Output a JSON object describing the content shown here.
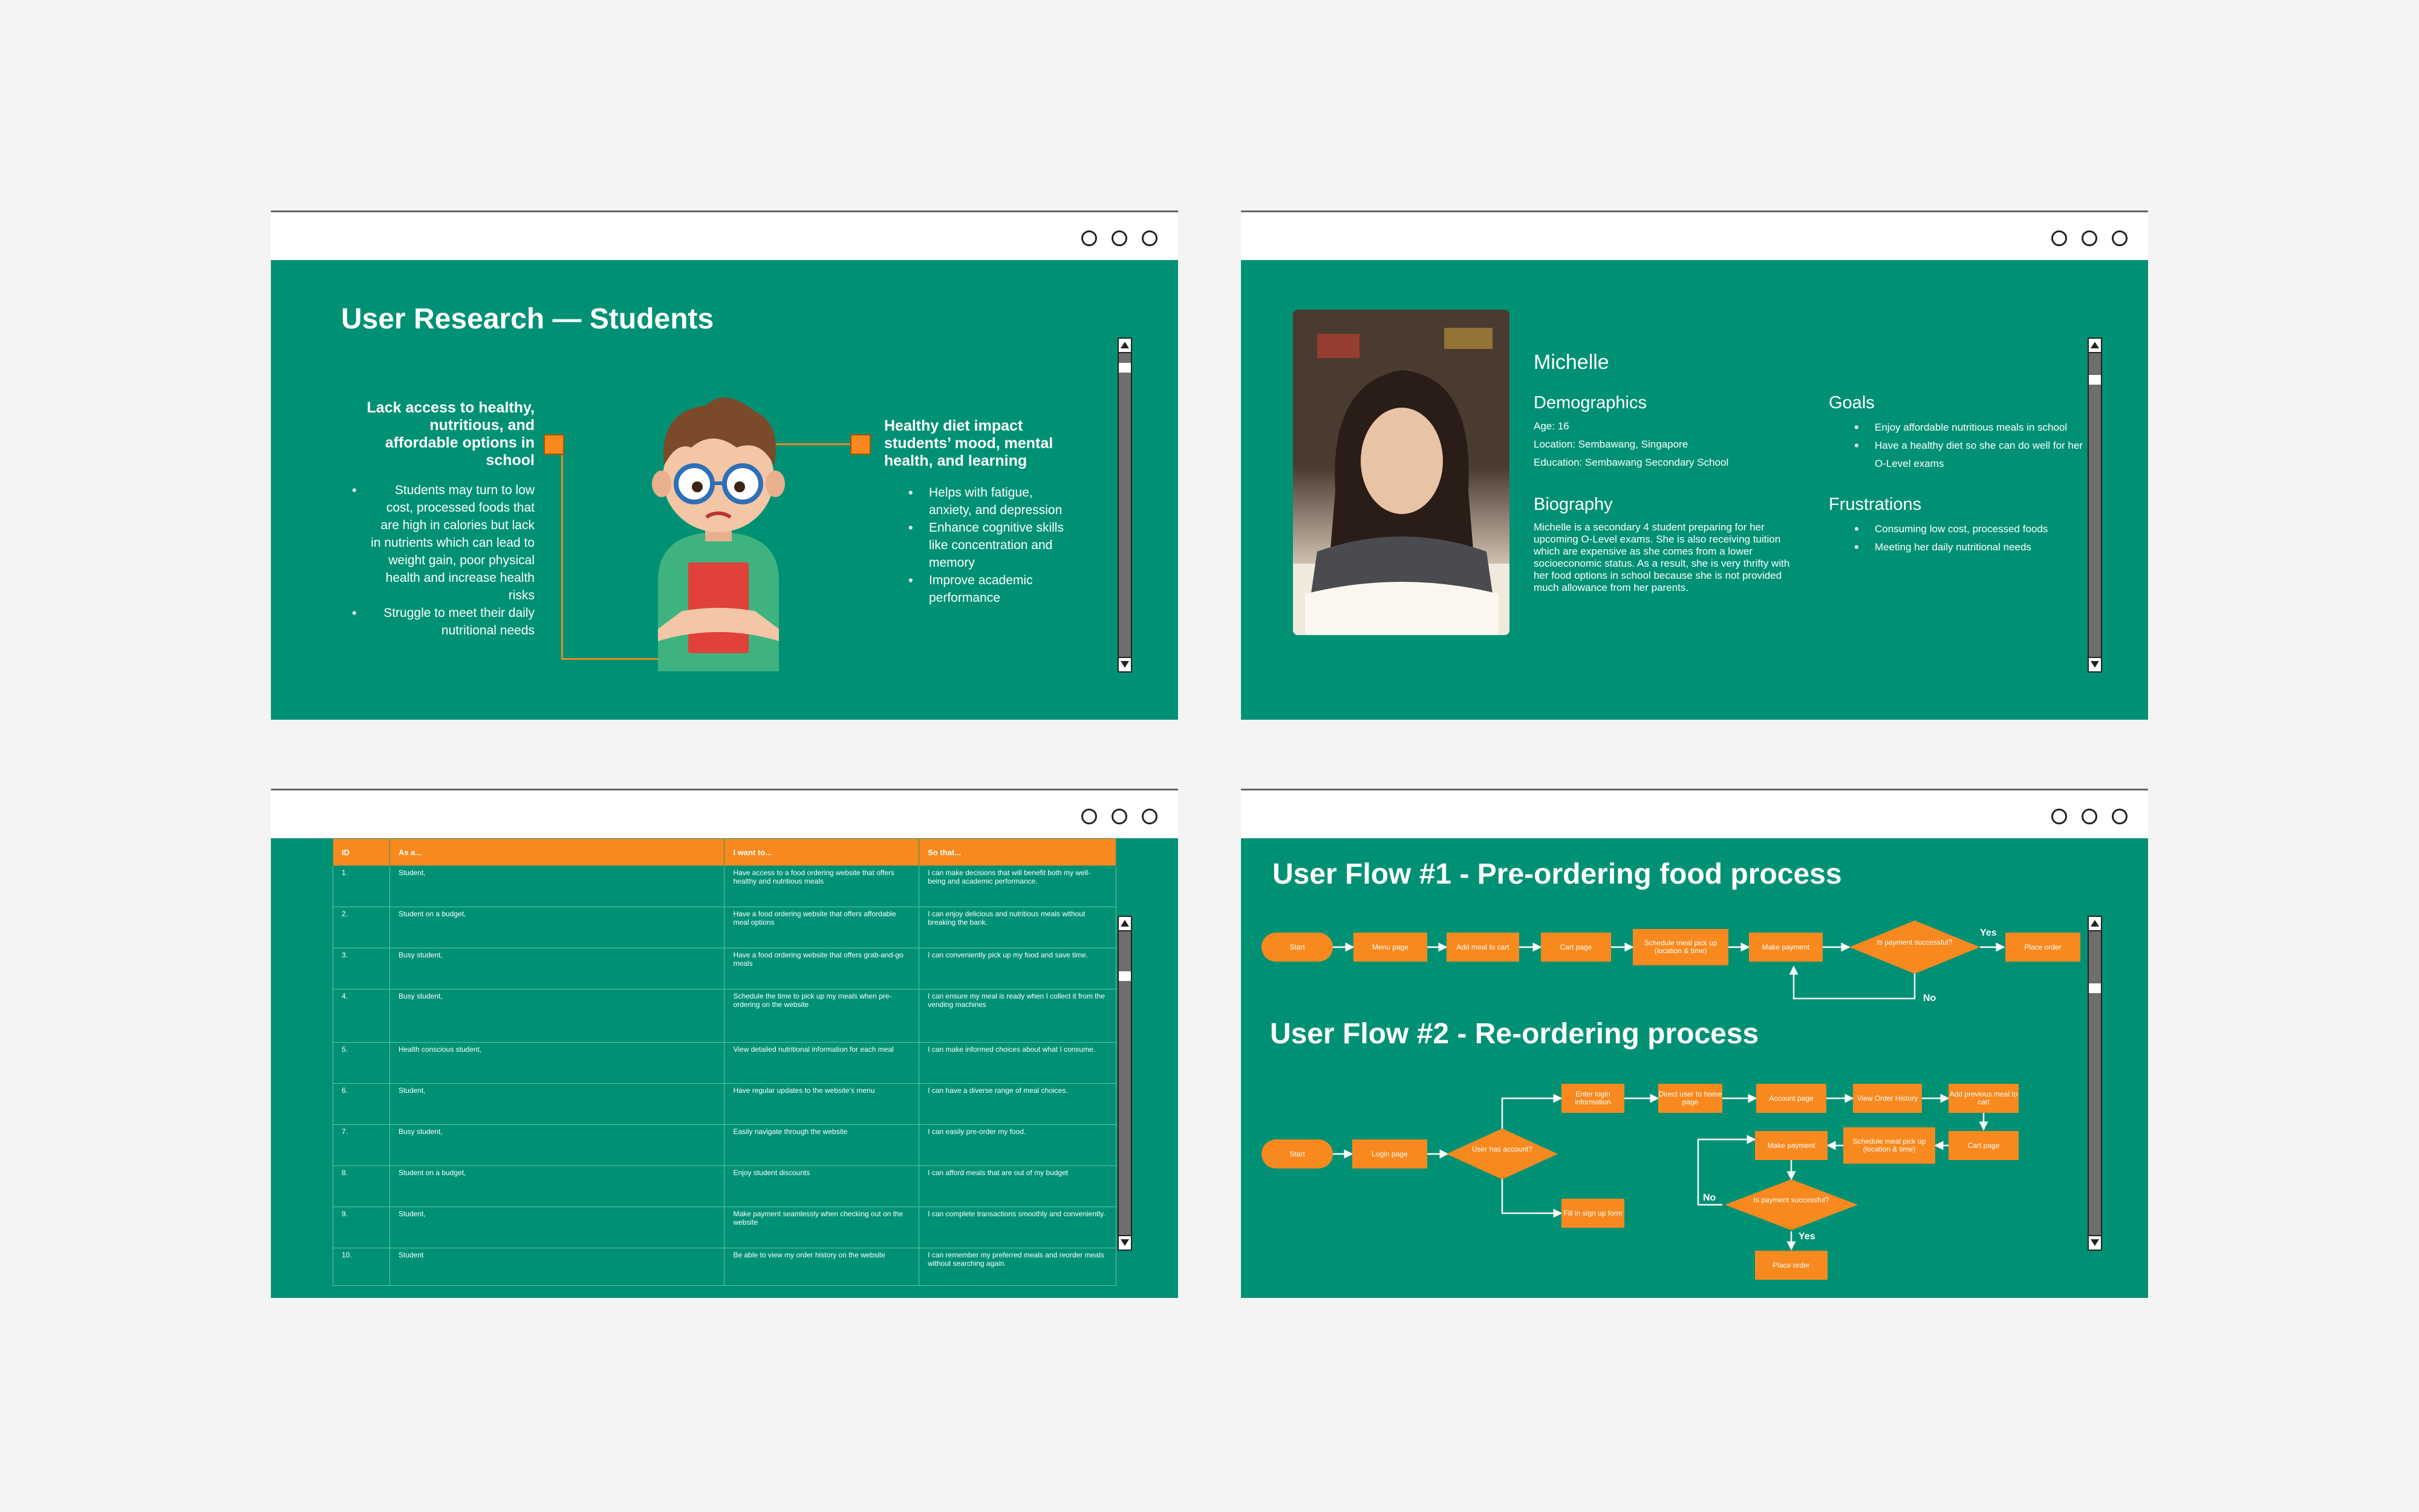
{
  "research": {
    "title": "User Research — Students",
    "left_heading": "Lack access to healthy, nutritious, and affordable options in school",
    "left_points": [
      "Students may turn to low cost, processed foods that are high in calories but lack in nutrients which can lead to weight gain, poor physical health and increase health risks",
      "Struggle to meet their daily nutritional needs"
    ],
    "right_heading": "Healthy diet impact students’ mood, mental health, and learning",
    "right_points": [
      "Helps with fatigue, anxiety, and depression",
      "Enhance cognitive skills like concentration and memory",
      "Improve academic performance"
    ]
  },
  "persona": {
    "name": "Michelle",
    "demographics_title": "Demographics",
    "demographics": [
      "Age: 16",
      "Location: Sembawang, Singapore",
      "Education: Sembawang Secondary School"
    ],
    "biography_title": "Biography",
    "biography": "Michelle is a secondary 4 student preparing for her upcoming O-Level exams. She is also receiving tuition which are expensive as she comes from a lower socioeconomic status. As a result, she is very thrifty with her food options in school because she is not provided much allowance from her parents.",
    "goals_title": "Goals",
    "goals": [
      "Enjoy affordable nutritious meals in school",
      "Have a healthy diet so she can do well for her O-Level exams"
    ],
    "frustrations_title": "Frustrations",
    "frustrations": [
      "Consuming low cost, processed foods",
      "Meeting her daily nutritional needs"
    ]
  },
  "stories": {
    "headers": [
      "ID",
      "As a...",
      "I want to...",
      "So that..."
    ],
    "rows": [
      {
        "id": "1.",
        "as": "Student,",
        "want": "Have access to a food ordering website that offers healthy and nutritious meals",
        "so": "I can make decisions that will benefit both my well-being and academic performance."
      },
      {
        "id": "2.",
        "as": "Student on a budget,",
        "want": "Have a food ordering website that offers affordable meal options",
        "so": "I can enjoy delicious and nutritious meals without breaking the bank."
      },
      {
        "id": "3.",
        "as": "Busy student,",
        "want": "Have a food ordering website that offers grab-and-go meals",
        "so": "I can conveniently pick up my food and save time."
      },
      {
        "id": "4.",
        "as": "Busy student,",
        "want": "Schedule the time to pick up my meals when pre-ordering on the website",
        "so": "I can ensure my meal is ready when I collect it from the vending machines"
      },
      {
        "id": "5.",
        "as": "Health conscious student,",
        "want": "View detailed nutritional information for each meal",
        "so": "I can make informed choices about what I consume."
      },
      {
        "id": "6.",
        "as": "Student,",
        "want": "Have regular updates to the website’s menu",
        "so": "I can have a diverse range of meal choices."
      },
      {
        "id": "7.",
        "as": "Busy student,",
        "want": "Easily navigate through the website",
        "so": "I can easily pre-order my food."
      },
      {
        "id": "8.",
        "as": "Student on a budget,",
        "want": "Enjoy student discounts",
        "so": "I can afford meals that are out of my budget"
      },
      {
        "id": "9.",
        "as": "Student,",
        "want": "Make payment seamlessly when checking out on the website",
        "so": "I can complete transactions smoothly and conveniently."
      },
      {
        "id": "10.",
        "as": "Student",
        "want": "Be able to view my order history on the website",
        "so": "I can remember my preferred meals and reorder meals without searching again."
      }
    ]
  },
  "flow1": {
    "title": "User Flow #1 - Pre-ordering food process",
    "start": "Start",
    "menu": "Menu page",
    "add": "Add meal to cart",
    "cart": "Cart page",
    "schedule": "Schedule meal pick up (location & time)",
    "pay": "Make payment",
    "decision": "Is payment successful?",
    "yes": "Yes",
    "no": "No",
    "place": "Place order"
  },
  "flow2": {
    "title": "User Flow #2 - Re-ordering process",
    "start": "Start",
    "login": "Login page",
    "has_account": "User has account?",
    "enter_login": "Enter login information",
    "direct_home": "Direct user to home page",
    "account": "Account page",
    "history": "View Order History",
    "add_prev": "Add previous meal to cart",
    "signup": "Fill in sign up form",
    "pay": "Make payment",
    "schedule": "Schedule meal pick up (location & time)",
    "cart": "Cart page",
    "decision": "Is payment successful?",
    "yes": "Yes",
    "no": "No",
    "place": "Place order"
  }
}
